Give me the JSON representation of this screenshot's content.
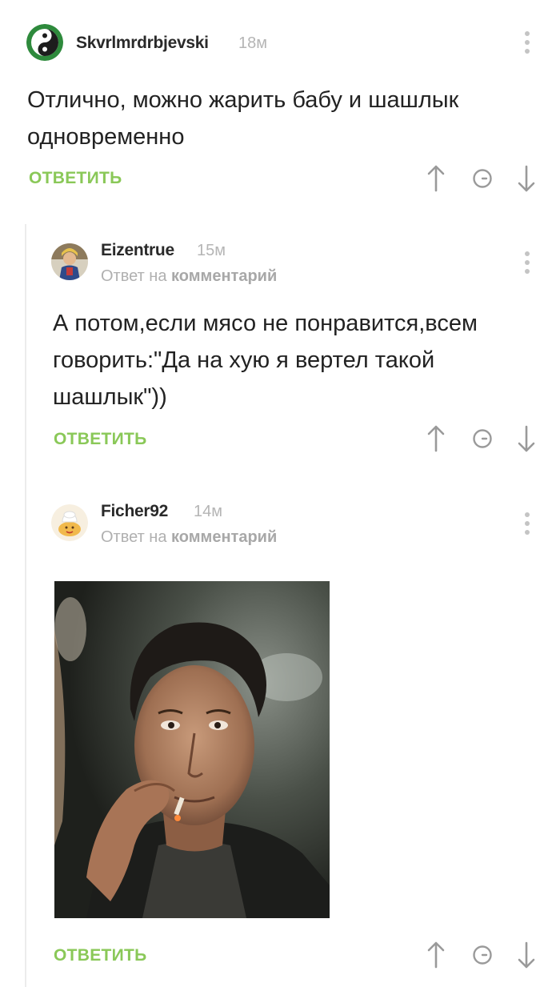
{
  "comments": [
    {
      "username": "Skvrlmrdrbjevski",
      "time": "18м",
      "text_lines": [
        "Отлично, можно жарить бабу и шашлык",
        "одновременно"
      ],
      "reply_label": "ОТВЕТИТЬ",
      "avatar_icon": "yin-yang-icon"
    },
    {
      "username": "Eizentrue",
      "time": "15м",
      "reply_prefix": "Ответ на",
      "reply_target": "комментарий",
      "text_lines": [
        "А потом,если мясо не понравится,всем",
        "говорить:\"Да на хую я вертел такой",
        "шашлык\"))"
      ],
      "reply_label": "ОТВЕТИТЬ",
      "avatar_icon": "user-avatar-icon"
    },
    {
      "username": "Ficher92",
      "time": "14м",
      "reply_prefix": "Ответ на",
      "reply_target": "комментарий",
      "reply_label": "ОТВЕТИТЬ",
      "avatar_icon": "cartoon-avatar-icon",
      "image_icon": "man-smoking-photo"
    }
  ],
  "icons": {
    "menu": "more-vertical-icon",
    "upvote": "arrow-up-icon",
    "save": "clock-icon",
    "downvote": "arrow-down-icon"
  },
  "colors": {
    "accent": "#8ac858",
    "muted": "#b5b5b5",
    "text": "#222222"
  }
}
